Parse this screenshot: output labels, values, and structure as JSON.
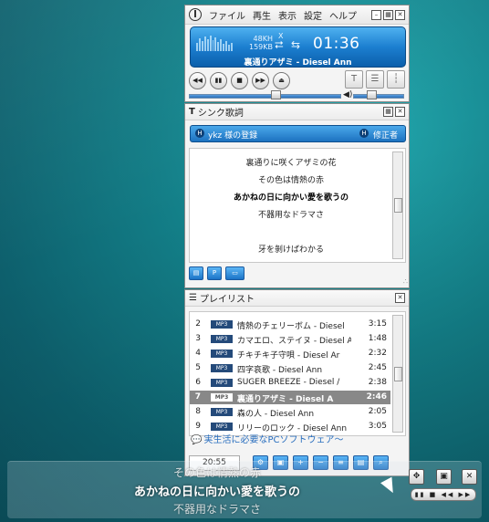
{
  "main_window": {
    "menu": [
      "ファイル",
      "再生",
      "表示",
      "設定",
      "ヘルプ"
    ],
    "display": {
      "sample_rate": "48KH",
      "bitrate": "159KB",
      "stereo_mark": "X",
      "time": "01:36",
      "now_playing": "裏通りアザミ - Diesel Ann"
    },
    "controls": {
      "prev": "◀◀",
      "pause": "▮▮",
      "stop": "■",
      "next": "▶▶",
      "eject": "⏏"
    },
    "seek_fraction": 0.56,
    "volume_fraction": 0.3
  },
  "lyrics_window": {
    "title": "シンク歌詞",
    "registrant": "ykz 様の登録",
    "editor": "修正者",
    "lines": [
      "裏通りに咲くアザミの花",
      "その色は情熱の赤",
      "あかねの日に向かい愛を歌うの",
      "不器用なドラマさ",
      "",
      "牙を剝けばわかる"
    ],
    "active_index": 2
  },
  "playlist_window": {
    "title": "プレイリスト",
    "rows": [
      {
        "num": "2",
        "fmt": "MP3",
        "title": "情熱のチェリーボム - Diesel",
        "dur": "3:15"
      },
      {
        "num": "3",
        "fmt": "MP3",
        "title": "カマエロ、ステイヌ - Diesel A",
        "dur": "1:48"
      },
      {
        "num": "4",
        "fmt": "MP3",
        "title": "チキチキ子守唄 - Diesel Ar",
        "dur": "2:32"
      },
      {
        "num": "5",
        "fmt": "MP3",
        "title": "四字哀歌 - Diesel Ann",
        "dur": "2:45"
      },
      {
        "num": "6",
        "fmt": "MP3",
        "title": "SUGER BREEZE - Diesel /",
        "dur": "2:38"
      },
      {
        "num": "7",
        "fmt": "MP3",
        "title": "裏通りアザミ - Diesel A",
        "dur": "2:46"
      },
      {
        "num": "8",
        "fmt": "MP3",
        "title": "森の人 - Diesel Ann",
        "dur": "2:05"
      },
      {
        "num": "9",
        "fmt": "MP3",
        "title": "リリーのロック - Diesel Ann",
        "dur": "3:05"
      }
    ],
    "selected_index": 5,
    "ad_text": "実生活に必要なPCソフトウェア〜",
    "total_time": "20:55"
  },
  "desktop_lyrics": {
    "prev": "その色は情熱の赤",
    "current": "あかねの日に向かい愛を歌うの",
    "next": "不器用なドラマさ"
  }
}
